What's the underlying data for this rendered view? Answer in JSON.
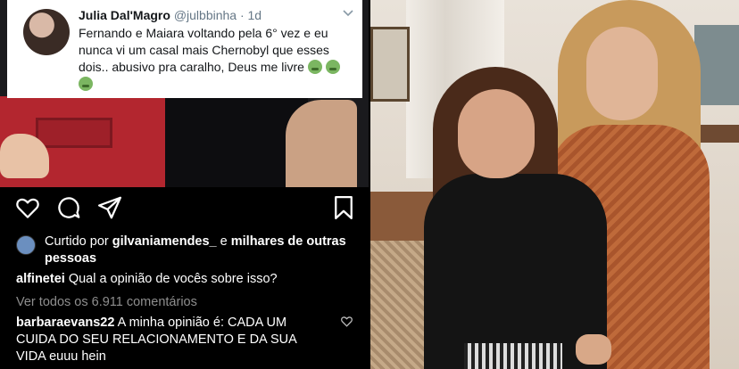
{
  "tweet": {
    "author_name": "Julia Dal'Magro",
    "author_handle": "@julbbinha",
    "time": "· 1d",
    "text": "Fernando e Maiara voltando pela 6° vez e eu nunca vi um casal mais Chernobyl que esses dois.. abusivo pra caralho, Deus me livre",
    "emoji_count": 3,
    "emoji_icon": "nauseated-face-icon"
  },
  "post": {
    "action_icons": [
      "heart-icon",
      "comment-icon",
      "share-icon",
      "bookmark-icon"
    ],
    "likes": {
      "prefix": "Curtido por ",
      "user": "gilvaniamendes_",
      "middle": " e ",
      "rest": "milhares de outras pessoas"
    },
    "caption": {
      "user": "alfinetei",
      "text": " Qual a opinião de vocês sobre isso?"
    },
    "view_all": "Ver todos os 6.911 comentários",
    "comment": {
      "user": "barbaraevans22",
      "text": " A minha opinião é: CADA UM CUIDA DO SEU RELACIONAMENTO  E DA SUA VIDA euuu hein"
    }
  },
  "colors": {
    "instagram_bg": "#000000",
    "muted_text": "#8e8e8e",
    "twitter_handle": "#657786"
  }
}
